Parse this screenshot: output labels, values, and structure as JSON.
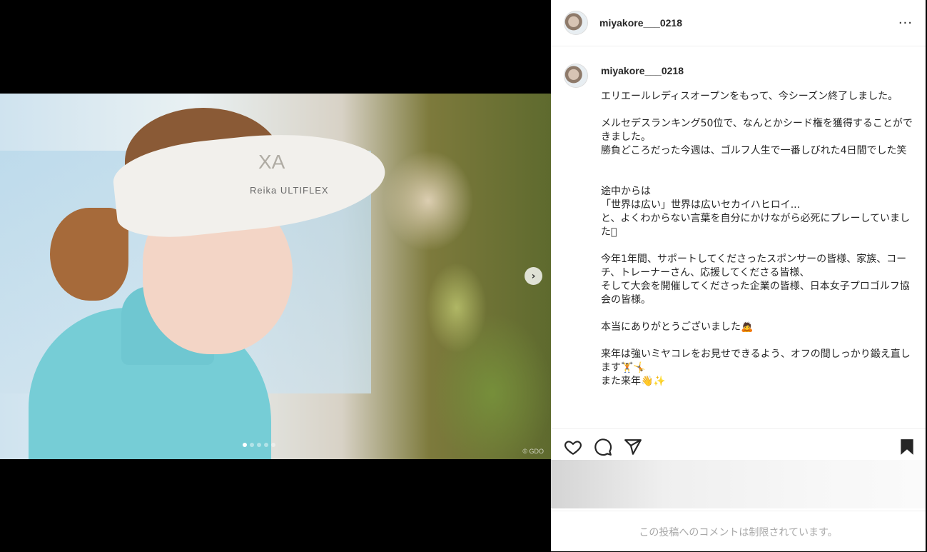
{
  "post": {
    "username": "miyakore___0218",
    "more_label": "···",
    "caption_username": "miyakore___0218",
    "caption": "エリエールレディスオープンをもって、今シーズン終了しました。\n\nメルセデスランキング50位で、なんとかシード権を獲得することができました。\n勝負どころだった今週は、ゴルフ人生で一番しびれた4日間でした笑\n\n\n途中からは\n「世界は広い」世界は広いセカイハヒロイ...\nと、よくわからない言葉を自分にかけながら必死にプレーしていました󾌧\n\n今年1年間、サポートしてくださったスポンサーの皆様、家族、コーチ、トレーナーさん、応援してくださる皆様、\nそして大会を開催してくださった企業の皆様、日本女子プロゴルフ協会の皆様。\n\n本当にありがとうございました🙇\n\n来年は強いミヤコレをお見せできるよう、オフの間しっかり鍛え直します🏋️🤸\nまた来年👋✨",
    "comments_restricted": "この投稿へのコメントは制限されています。"
  },
  "media": {
    "next_icon": "chevron-right-icon",
    "next_label": "›",
    "slide_count": 5,
    "active_slide": 1,
    "photo_brand": "XA",
    "photo_visor_text": "Reika  ULTIFLEX",
    "photo_copyright": "© GDO"
  },
  "actions": {
    "like_icon": "heart-icon",
    "comment_icon": "comment-icon",
    "share_icon": "send-icon",
    "save_icon": "bookmark-icon"
  },
  "colors": {
    "text": "#262626",
    "muted": "#a8a8a8",
    "border": "#efefef"
  }
}
